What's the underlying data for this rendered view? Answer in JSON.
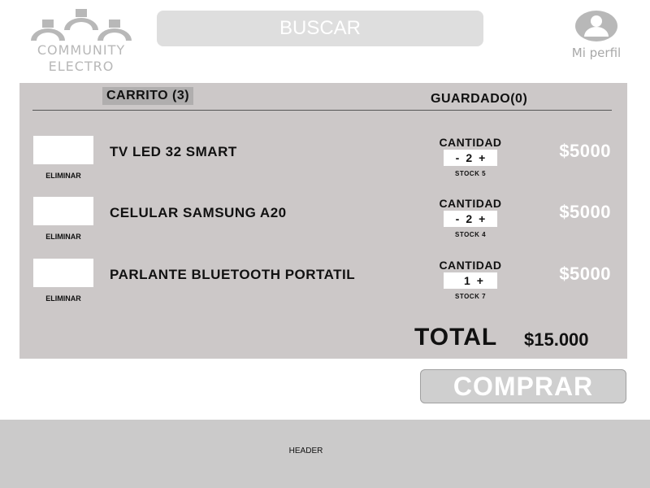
{
  "brand": {
    "line1": "COMMUNITY",
    "line2": "ELECTRO",
    "icon": "logo-lamps-icon"
  },
  "search": {
    "placeholder": "BUSCAR"
  },
  "profile": {
    "label": "Mi perfil",
    "icon": "user-icon"
  },
  "tabs": {
    "cart": "CARRITO (3)",
    "saved": "GUARDADO(0)"
  },
  "cart": {
    "items": [
      {
        "name": "TV LED 32 SMART",
        "remove": "ELIMINAR",
        "qty_label": "CANTIDAD",
        "minus": "-",
        "qty": "2",
        "plus": "+",
        "stock": "STOCK 5",
        "price": "$5000"
      },
      {
        "name": "CELULAR SAMSUNG A20",
        "remove": "ELIMINAR",
        "qty_label": "CANTIDAD",
        "minus": "-",
        "qty": "2",
        "plus": "+",
        "stock": "STOCK 4",
        "price": "$5000"
      },
      {
        "name": "PARLANTE BLUETOOTH PORTATIL",
        "remove": "ELIMINAR",
        "qty_label": "CANTIDAD",
        "minus": "",
        "qty": "1",
        "plus": "+",
        "stock": "STOCK 7",
        "price": "$5000"
      }
    ],
    "total_label": "TOTAL",
    "total_value": "$15.000"
  },
  "buy_button": "COMPRAR",
  "footer": {
    "label": "HEADER"
  },
  "colors": {
    "panel": "#ccc8c8",
    "search": "#dedede",
    "footer": "#cbcaca",
    "price": "#ffffff"
  }
}
